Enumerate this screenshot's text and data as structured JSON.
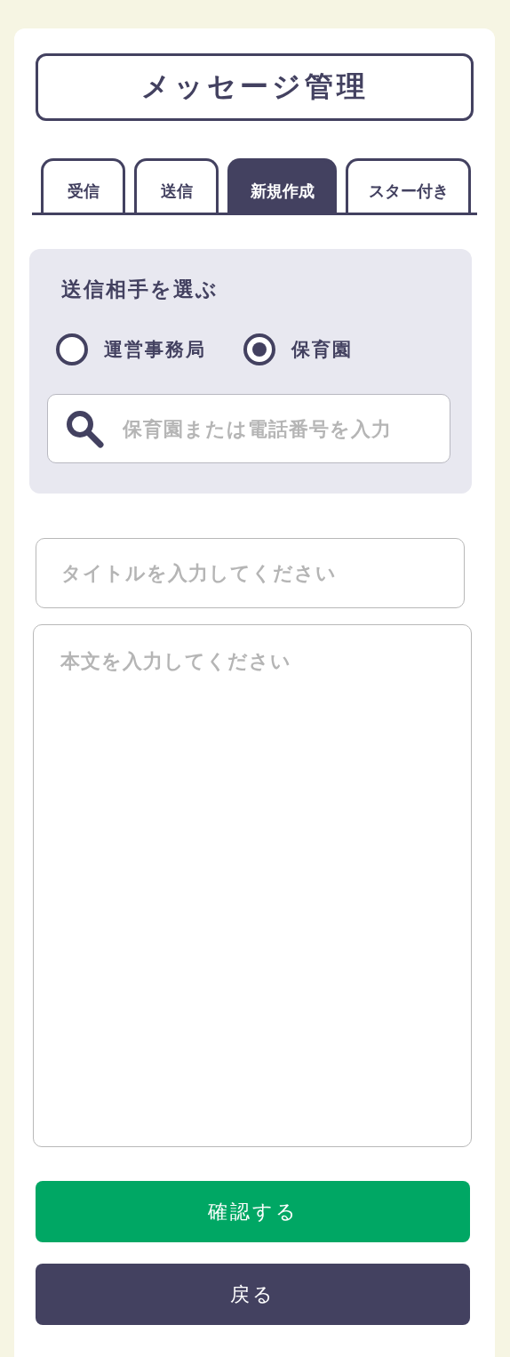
{
  "header": {
    "title": "メッセージ管理"
  },
  "tabs": [
    {
      "label": "受信",
      "selected": false
    },
    {
      "label": "送信",
      "selected": false
    },
    {
      "label": "新規作成",
      "selected": true
    },
    {
      "label": "スター付き",
      "selected": false
    }
  ],
  "recipient": {
    "heading": "送信相手を選ぶ",
    "options": [
      {
        "label": "運営事務局",
        "selected": false
      },
      {
        "label": "保育園",
        "selected": true
      }
    ],
    "search": {
      "placeholder": "保育園または電話番号を入力"
    }
  },
  "title_field": {
    "placeholder": "タイトルを入力してください"
  },
  "body_field": {
    "placeholder": "本文を入力してください"
  },
  "buttons": [
    {
      "label": "確認する",
      "kind": "primary"
    },
    {
      "label": "戻る",
      "kind": "secondary"
    }
  ]
}
